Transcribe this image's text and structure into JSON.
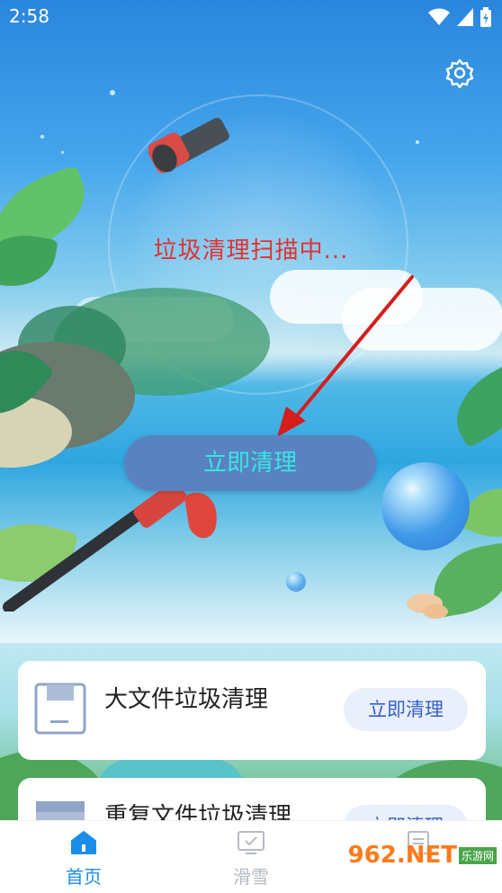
{
  "status_bar": {
    "time": "2:58",
    "icons": [
      "wifi-icon",
      "signal-icon",
      "battery-icon"
    ]
  },
  "header": {
    "settings_icon": "gear-icon"
  },
  "scan": {
    "status_text": "垃圾清理扫描中..."
  },
  "main_action": {
    "label": "立即清理"
  },
  "cards": [
    {
      "title": "大文件垃圾清理",
      "button": "立即清理",
      "icon": "document-icon"
    },
    {
      "title": "重复文件垃圾清理",
      "button": "立即清理",
      "icon": "browser-window-icon"
    }
  ],
  "bottom_nav": {
    "items": [
      {
        "label": "首页",
        "icon": "home-icon",
        "active": true
      },
      {
        "label": "滑雪",
        "icon": "monitor-icon",
        "active": false
      },
      {
        "label": "",
        "icon": "document-icon",
        "active": false
      }
    ]
  },
  "watermark": {
    "text": "962.NET",
    "subtext": "乐游网"
  },
  "colors": {
    "accent": "#3562c5",
    "scan_text": "#e53030",
    "main_button_bg": "#5b82c0",
    "main_button_text": "#36e6e6",
    "nav_active": "#1a8de8",
    "nav_inactive": "#b5bac3"
  }
}
